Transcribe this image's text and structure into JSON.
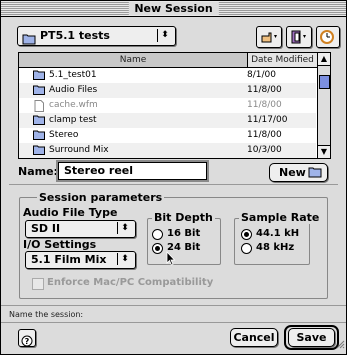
{
  "window": {
    "title": "New Session"
  },
  "location_popup": {
    "value": "PT5.1 tests"
  },
  "file_list": {
    "columns": {
      "name": "Name",
      "date": "Date Modified"
    },
    "rows": [
      {
        "name": "5.1_test01",
        "date": "8/1/00",
        "icon": "folder-icon",
        "dim": false
      },
      {
        "name": "Audio Files",
        "date": "11/8/00",
        "icon": "folder-icon",
        "dim": false
      },
      {
        "name": "cache.wfm",
        "date": "11/8/00",
        "icon": "document-icon",
        "dim": true
      },
      {
        "name": "clamp test",
        "date": "11/17/00",
        "icon": "folder-icon",
        "dim": false
      },
      {
        "name": "Stereo",
        "date": "11/8/00",
        "icon": "folder-icon",
        "dim": false
      },
      {
        "name": "Surround Mix",
        "date": "10/3/00",
        "icon": "folder-icon",
        "dim": false
      }
    ]
  },
  "name_field": {
    "label": "Name:",
    "value": "Stereo reel"
  },
  "new_folder_button": {
    "label": "New"
  },
  "session_params": {
    "title": "Session parameters",
    "audio_file_type": {
      "label": "Audio File Type",
      "value": "SD II"
    },
    "io_settings": {
      "label": "I/O Settings",
      "value": "5.1 Film Mix"
    },
    "bit_depth": {
      "label": "Bit Depth",
      "options": [
        "16 Bit",
        "24 Bit"
      ],
      "selected": "24 Bit"
    },
    "sample_rate": {
      "label": "Sample Rate",
      "options": [
        "44.1 kH",
        "48 kHz"
      ],
      "selected": "44.1 kH"
    },
    "compat": {
      "label": "Enforce Mac/PC Compatibility",
      "checked": false
    }
  },
  "status": {
    "text": "Name the session:"
  },
  "buttons": {
    "cancel": "Cancel",
    "save": "Save"
  }
}
